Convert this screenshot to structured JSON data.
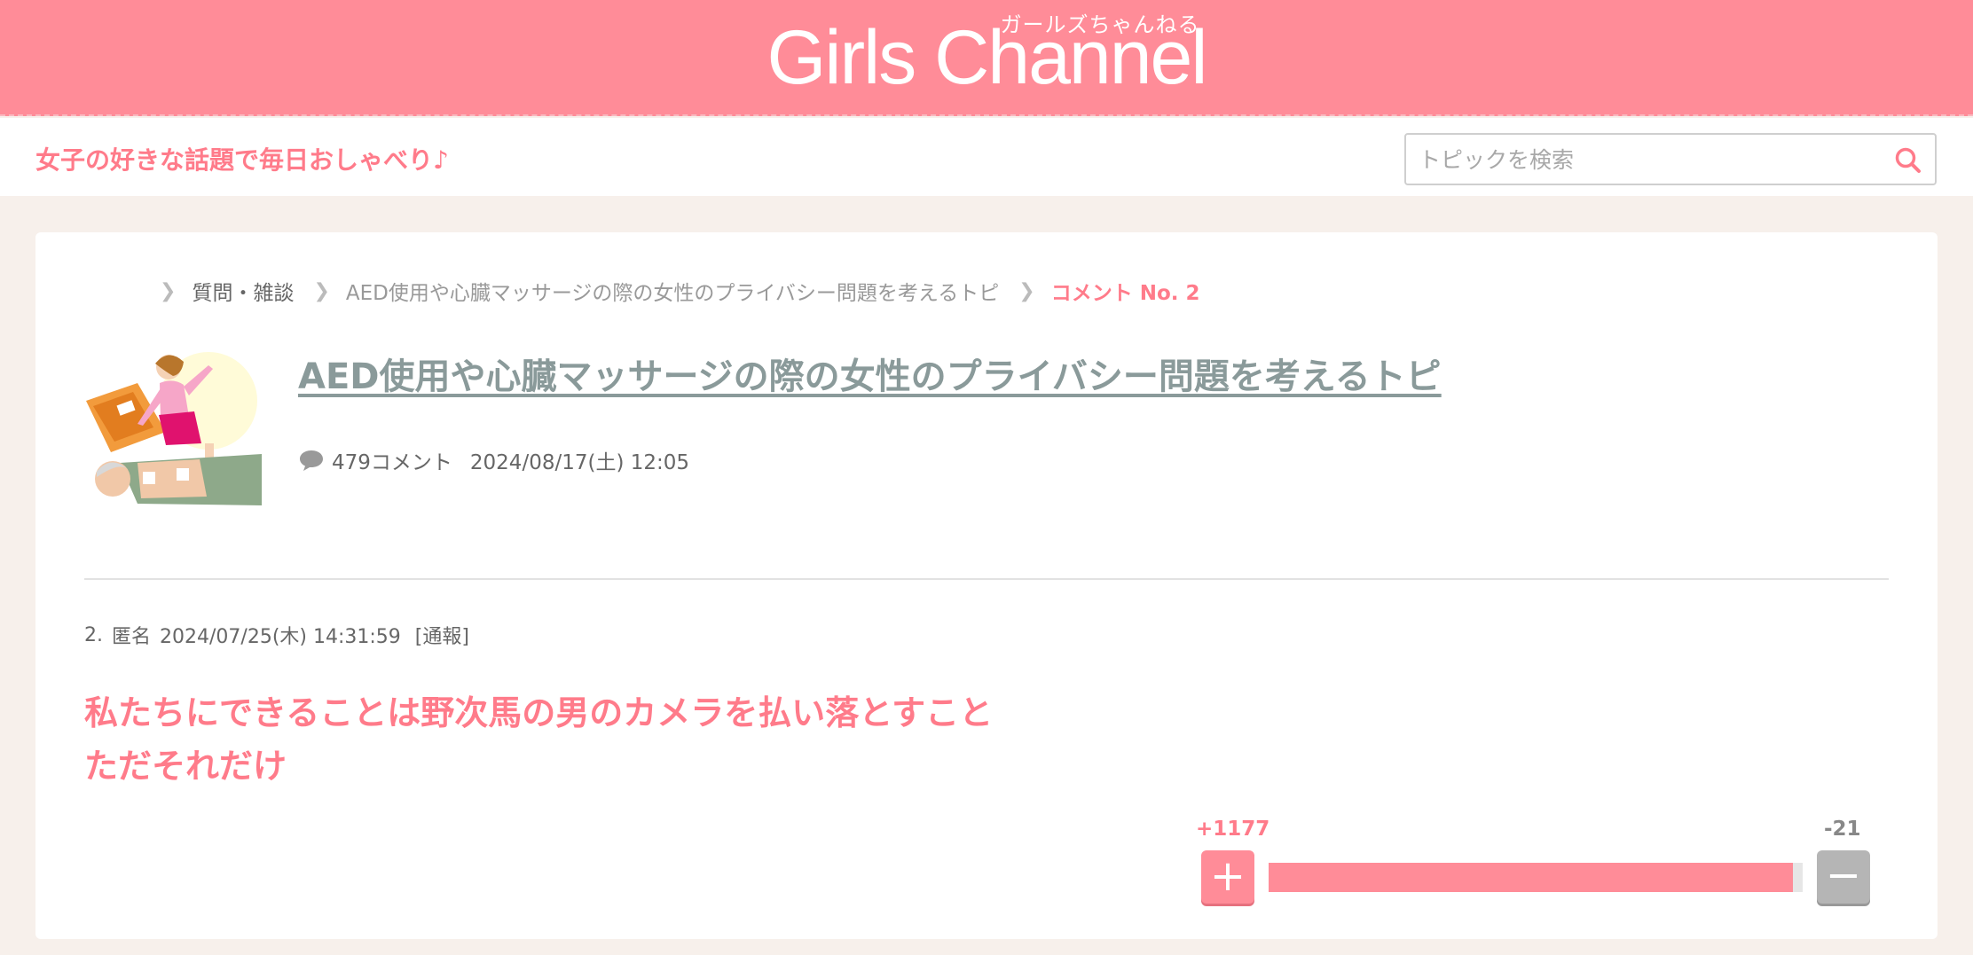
{
  "header": {
    "logo_kana": "ガールズちゃんねる",
    "logo_text": "Girls Channel"
  },
  "subheader": {
    "tagline": "女子の好きな話題で毎日おしゃべり♪",
    "search_placeholder": "トピックを検索"
  },
  "breadcrumb": {
    "items": [
      "質問・雑談",
      "AED使用や心臓マッサージの際の女性のプライバシー問題を考えるトピ",
      "コメント No. 2"
    ]
  },
  "topic": {
    "title": "AED使用や心臓マッサージの際の女性のプライバシー問題を考えるトピ",
    "comment_count": "479コメント",
    "datetime": "2024/08/17(土) 12:05"
  },
  "post": {
    "number": "2.",
    "author": "匿名",
    "datetime": "2024/07/25(木) 14:31:59",
    "report": "[通報]",
    "body_line1": "私たちにできることは野次馬の男のカメラを払い落とすこと",
    "body_line2": "ただそれだけ"
  },
  "votes": {
    "plus_label": "+1177",
    "minus_label": "-21",
    "plus_value": 1177,
    "minus_value": 21,
    "plus_symbol": "+",
    "minus_symbol": "−"
  },
  "colors": {
    "brand": "#ff8c98",
    "accent_text": "#ff7b8a",
    "background": "#f7f0eb"
  }
}
